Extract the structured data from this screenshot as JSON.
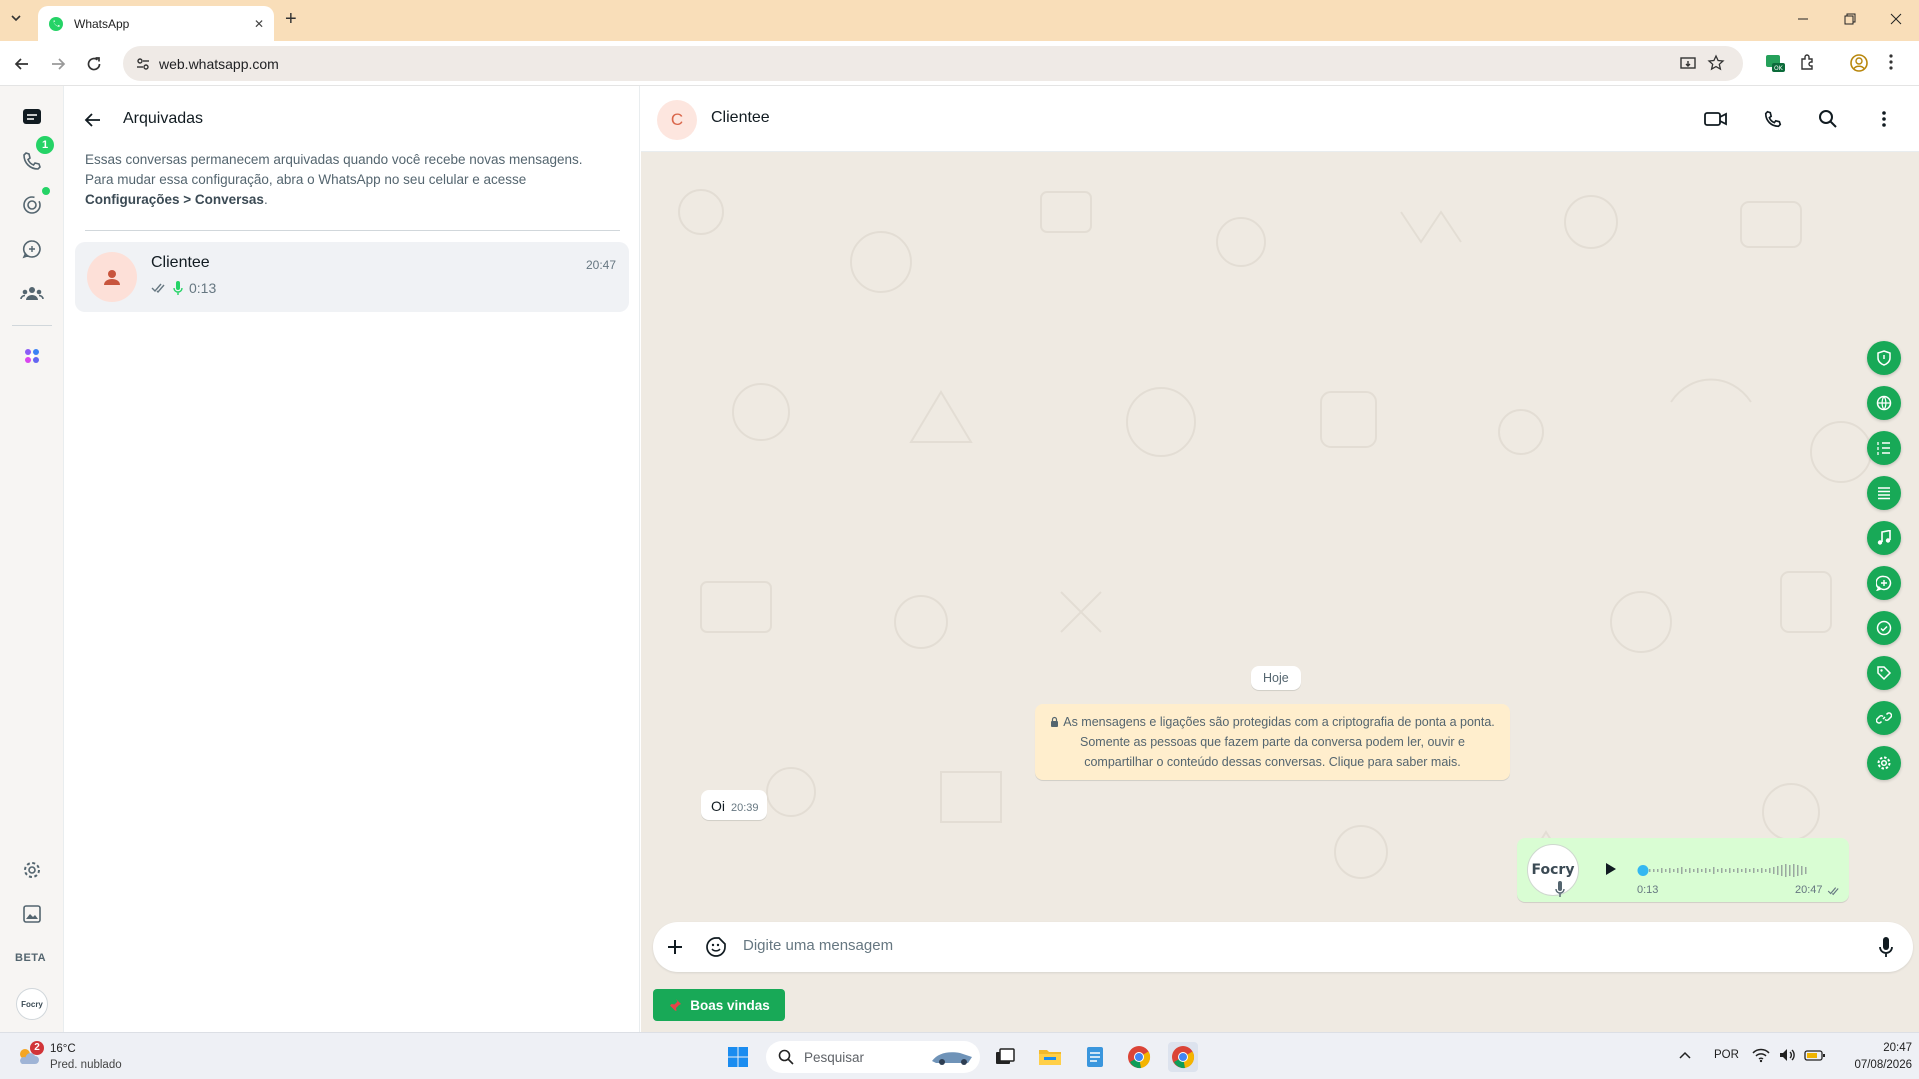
{
  "browser": {
    "tab_title": "WhatsApp",
    "url": "web.whatsapp.com",
    "tab_close": "✕",
    "new_tab": "+"
  },
  "rail": {
    "calls_badge": "1",
    "beta_label": "BETA",
    "profile_logo": "Focry"
  },
  "archived": {
    "title": "Arquivadas",
    "desc_line1": "Essas conversas permanecem arquivadas quando você recebe novas mensagens.",
    "desc_line2": "Para mudar essa configuração, abra o WhatsApp no seu celular e acesse",
    "desc_bold": "Configurações > Conversas",
    "desc_end": ".",
    "chat": {
      "name": "Clientee",
      "time": "20:47",
      "preview": "0:13"
    }
  },
  "conversation": {
    "contact_initial": "C",
    "contact_name": "Clientee",
    "date_label": "Hoje",
    "encryption_notice": "As mensagens e ligações são protegidas com a criptografia de ponta a ponta. Somente as pessoas que fazem parte da conversa podem ler, ouvir e compartilhar o conteúdo dessas conversas. Clique para saber mais.",
    "messages": [
      {
        "text": "Oi",
        "time": "20:39"
      }
    ],
    "audio": {
      "avatar_label": "Focry",
      "duration": "0:13",
      "time": "20:47",
      "progress": 0
    },
    "composer_placeholder": "Digite uma mensagem",
    "welcome_button": "Boas vindas"
  },
  "taskbar": {
    "weather_temp": "16°C",
    "weather_desc": "Pred. nublado",
    "weather_badge": "2",
    "search_placeholder": "Pesquisar",
    "language": "POR",
    "clock_time": "20:47",
    "clock_date": "07/08/2026"
  },
  "colors": {
    "accent": "#18a957",
    "tabbar": "#f9deb9",
    "wallpaper": "#efeae2",
    "outgoing_bubble": "#d9fdd3",
    "notice": "#ffeecd"
  }
}
